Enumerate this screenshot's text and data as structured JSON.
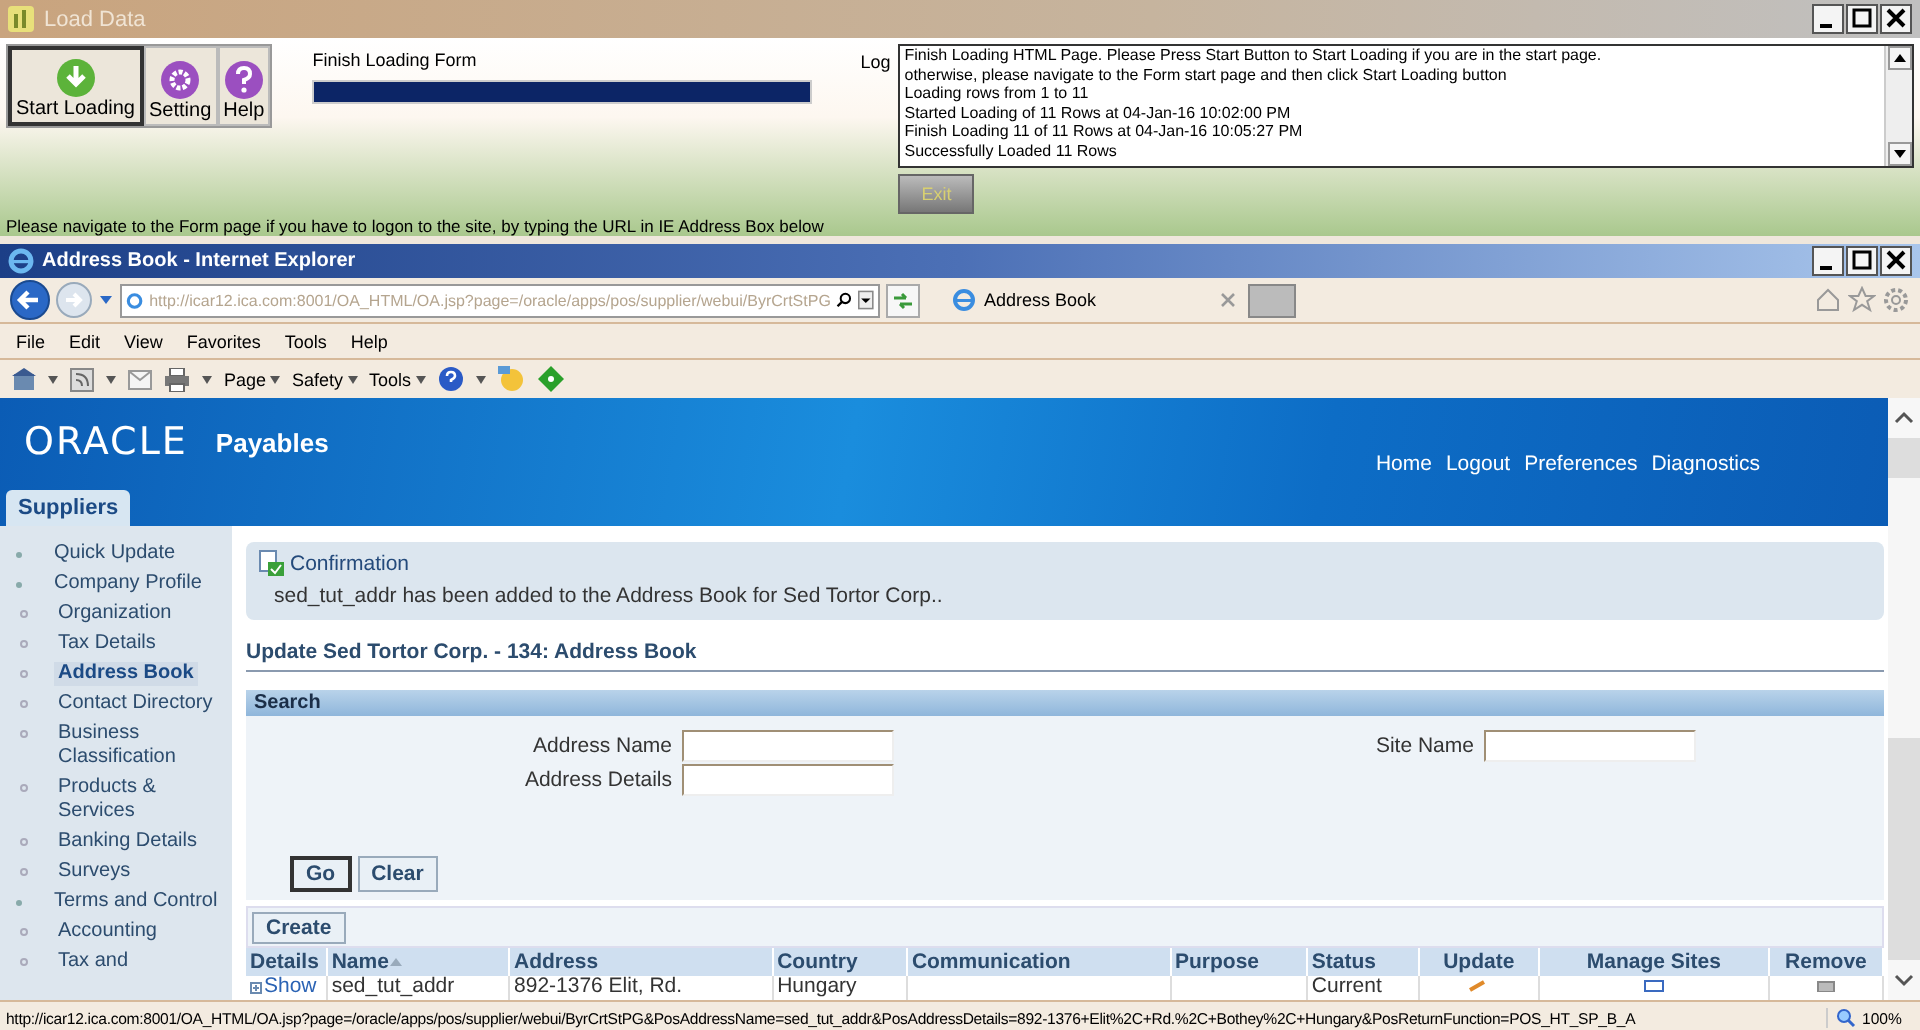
{
  "loader": {
    "title": "Load Data",
    "buttons": [
      {
        "label": "Start Loading",
        "kind": "start"
      },
      {
        "label": "Setting",
        "kind": "setting"
      },
      {
        "label": "Help",
        "kind": "help"
      }
    ],
    "form_label": "Finish Loading Form",
    "progress": {
      "level": 1
    },
    "log_label": "Log",
    "log_lines": [
      "Finish Loading HTML Page. Please Press Start Button to Start Loading if you are in the start page.",
      "otherwise, please navigate to the Form start page and then click Start Loading button",
      "Loading rows from 1 to 11",
      "Started Loading of 11 Rows at 04-Jan-16 10:02:00 PM",
      "Finish Loading 11 of 11 Rows at 04-Jan-16 10:05:27 PM",
      "Successfully Loaded 11 Rows"
    ],
    "exit_button": {
      "label": "Exit",
      "disabled": true
    },
    "hint": "Please navigate to the Form page if you have to logon to the site, by typing the URL in IE Address Box below"
  },
  "browser": {
    "title": "Address Book - Internet Explorer",
    "url": "http://icar12.ica.com:8001/OA_HTML/OA.jsp?page=/oracle/apps/pos/supplier/webui/ByrCrtStPG",
    "tab": "Address Book",
    "menu": [
      "File",
      "Edit",
      "View",
      "Favorites",
      "Tools",
      "Help"
    ],
    "command_bar": [
      "Page",
      "Safety",
      "Tools"
    ],
    "status_url": "http://icar12.ica.com:8001/OA_HTML/OA.jsp?page=/oracle/apps/pos/supplier/webui/ByrCrtStPG&PosAddressName=sed_tut_addr&PosAddressDetails=892-1376+Elit%2C+Rd.%2C+Bothey%2C+Hungary&PosReturnFunction=POS_HT_SP_B_A",
    "zoom": "100%"
  },
  "app": {
    "logo": "ORACLE",
    "product": "Payables",
    "global_links": [
      "Home",
      "Logout",
      "Preferences",
      "Diagnostics"
    ],
    "tabs": [
      {
        "label": "Suppliers",
        "selected": true
      }
    ],
    "sidebar": [
      {
        "label": "Quick Update",
        "selected": false
      },
      {
        "label": "Company Profile",
        "selected": false,
        "children": [
          {
            "label": "Organization",
            "selected": false
          },
          {
            "label": "Tax Details",
            "selected": false
          },
          {
            "label": "Address Book",
            "selected": true
          },
          {
            "label": "Contact Directory",
            "selected": false
          },
          {
            "label": "Business Classification",
            "selected": false
          },
          {
            "label": "Products & Services",
            "selected": false
          },
          {
            "label": "Banking Details",
            "selected": false
          },
          {
            "label": "Surveys",
            "selected": false
          }
        ]
      },
      {
        "label": "Terms and Control",
        "selected": false,
        "children": [
          {
            "label": "Accounting",
            "selected": false
          },
          {
            "label": "Tax and",
            "selected": false
          }
        ]
      }
    ],
    "confirmation": {
      "title": "Confirmation",
      "message": "sed_tut_addr has been added to the Address Book for Sed Tortor Corp.."
    },
    "page_title": "Update Sed Tortor Corp. - 134: Address Book",
    "search": {
      "title": "Search",
      "fields": [
        {
          "label": "Address Name"
        },
        {
          "label": "Address Details"
        },
        {
          "label": "Site Name"
        }
      ],
      "buttons": [
        "Go",
        "Clear"
      ]
    },
    "create_button": "Create",
    "table": {
      "columns": [
        {
          "label": "Details",
          "sorted": false
        },
        {
          "label": "Name",
          "sorted": true
        },
        {
          "label": "Address",
          "sorted": false
        },
        {
          "label": "Country",
          "sorted": false
        },
        {
          "label": "Communication",
          "sorted": false
        },
        {
          "label": "Purpose",
          "sorted": false
        },
        {
          "label": "Status",
          "sorted": false
        },
        {
          "label": "Update",
          "sorted": false
        },
        {
          "label": "Manage Sites",
          "sorted": false
        },
        {
          "label": "Remove",
          "sorted": false
        }
      ],
      "rows": [
        {
          "details": "Show",
          "name": "sed_tut_addr",
          "address": "892-1376 Elit, Rd.",
          "country": "Hungary",
          "status": "Current"
        }
      ]
    }
  }
}
